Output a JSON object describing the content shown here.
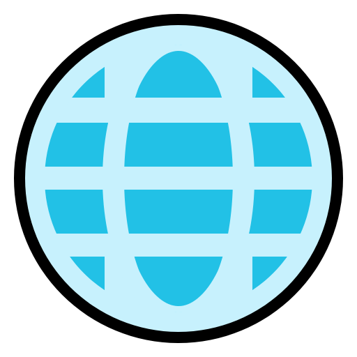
{
  "icon": {
    "name": "globe-icon",
    "colors": {
      "outline": "#000000",
      "globe_background": "#C7F1FD",
      "land_segments": "#22C1E6"
    }
  }
}
